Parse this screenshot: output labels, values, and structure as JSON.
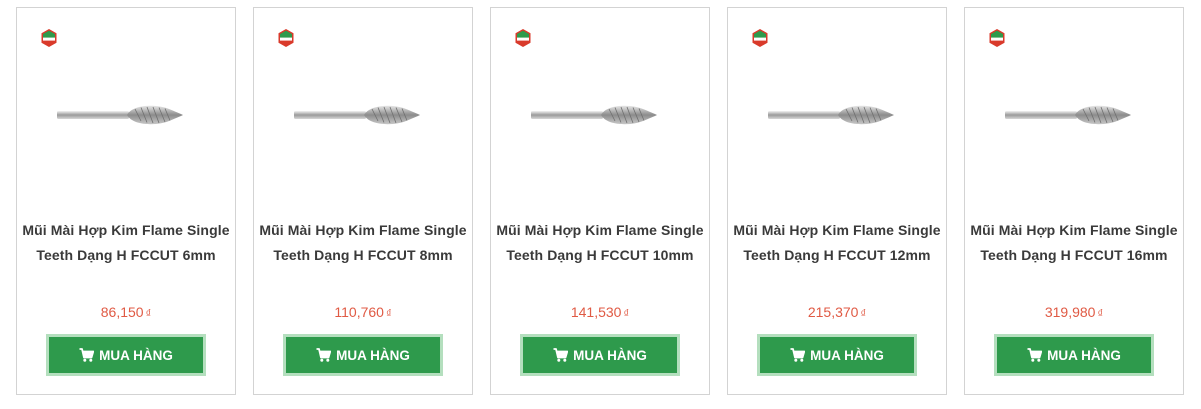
{
  "badge_icon": "gisi-tools-badge-icon",
  "cart_icon": "shopping-cart-icon",
  "colors": {
    "price": "#e05a44",
    "button": "#2e9a4c",
    "button_border": "#b4dfbe",
    "name": "#3a3a3a"
  },
  "products": [
    {
      "name_line1": "Mũi Mài Hợp Kim Flame Single",
      "name_line2": "Teeth Dạng H FCCUT 6mm",
      "price": "86,150",
      "currency": "₫",
      "button_label": "MUA HÀNG"
    },
    {
      "name_line1": "Mũi Mài Hợp Kim Flame Single",
      "name_line2": "Teeth Dạng H FCCUT 8mm",
      "price": "110,760",
      "currency": "₫",
      "button_label": "MUA HÀNG"
    },
    {
      "name_line1": "Mũi Mài Hợp Kim Flame Single",
      "name_line2": "Teeth Dạng H FCCUT 10mm",
      "price": "141,530",
      "currency": "₫",
      "button_label": "MUA HÀNG"
    },
    {
      "name_line1": "Mũi Mài Hợp Kim Flame Single",
      "name_line2": "Teeth Dạng H FCCUT 12mm",
      "price": "215,370",
      "currency": "₫",
      "button_label": "MUA HÀNG"
    },
    {
      "name_line1": "Mũi Mài Hợp Kim Flame Single",
      "name_line2": "Teeth Dạng H FCCUT 16mm",
      "price": "319,980",
      "currency": "₫",
      "button_label": "MUA HÀNG"
    }
  ]
}
